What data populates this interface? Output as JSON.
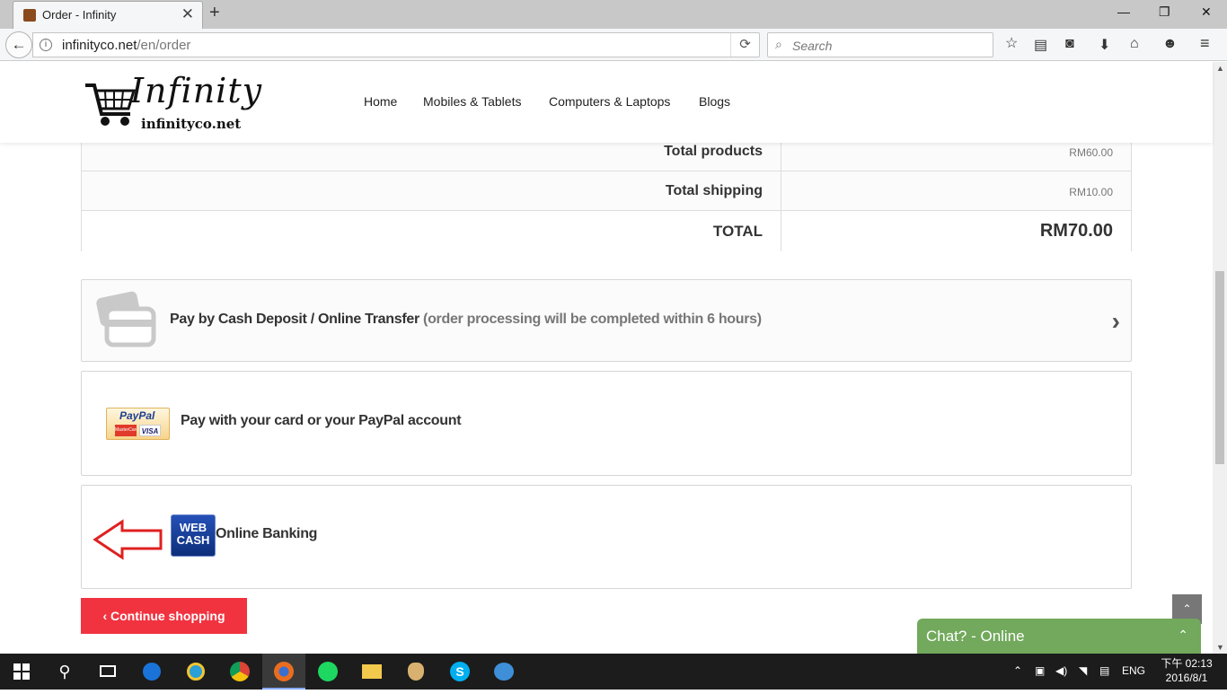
{
  "browser": {
    "tab_title": "Order - Infinity",
    "tab_close": "✕",
    "new_tab": "+",
    "url_host": "infinityco.net",
    "url_path": "/en/order",
    "search_placeholder": "Search",
    "win_min": "—",
    "win_restore": "❐",
    "win_close": "✕"
  },
  "site": {
    "logo_brand": "Infinity",
    "logo_domain": "infinityco.net",
    "nav": [
      "Home",
      "Mobiles & Tablets",
      "Computers & Laptops",
      "Blogs"
    ]
  },
  "totals": {
    "rows": [
      {
        "label": "Total products",
        "value": "RM60.00"
      },
      {
        "label": "Total shipping",
        "value": "RM10.00"
      },
      {
        "label": "TOTAL",
        "value": "RM70.00"
      }
    ]
  },
  "payment": {
    "cash_title": "Pay by Cash Deposit / Online Transfer",
    "cash_note": "(order processing will be completed within 6 hours)",
    "paypal_logo_text": "PayPal",
    "paypal_card1": "MasterCard",
    "paypal_card2": "VISA",
    "paypal_title": "Pay with your card or your PayPal account",
    "webcash_line1": "WEB",
    "webcash_line2": "CASH",
    "online_banking": "Online Banking"
  },
  "buttons": {
    "continue_shopping": "‹ Continue shopping",
    "to_top": "⌃"
  },
  "chat": {
    "label": "Chat? - Online",
    "toggle": "⌃"
  },
  "taskbar": {
    "lang": "ENG",
    "time": "下午 02:13",
    "date": "2016/8/1"
  },
  "colors": {
    "continue_button": "#f13340",
    "chat_bar": "#72a95c",
    "arrow_annotation": "#e02020"
  }
}
